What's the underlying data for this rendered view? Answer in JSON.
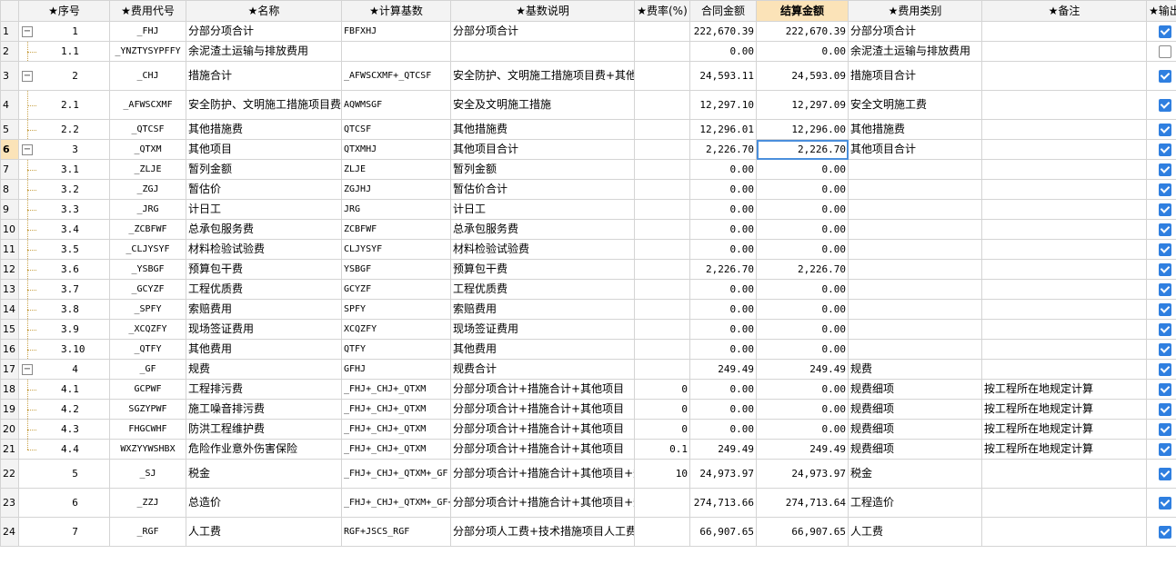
{
  "headers": {
    "seq": "★序号",
    "code": "★费用代号",
    "name": "★名称",
    "base": "★计算基数",
    "desc": "★基数说明",
    "rate": "★费率(%)",
    "contract": "合同金额",
    "settle": "结算金额",
    "category": "★费用类别",
    "note": "★备注",
    "output": "★输出"
  },
  "rows": [
    {
      "n": "1",
      "seq": "1",
      "level": 0,
      "toggle": "−",
      "code": "_FHJ",
      "name": "分部分项合计",
      "base": "FBFXHJ",
      "desc": "分部分项合计",
      "rate": "",
      "contract": "222,670.39",
      "settle": "222,670.39",
      "category": "分部分项合计",
      "note": "",
      "output": true
    },
    {
      "n": "2",
      "seq": "1.1",
      "level": 1,
      "code": "_YNZTYSYPFFY",
      "name": "余泥渣土运输与排放费用",
      "base": "",
      "desc": "",
      "rate": "",
      "contract": "0.00",
      "settle": "0.00",
      "category": "余泥渣土运输与排放费用",
      "note": "",
      "output": false
    },
    {
      "n": "3",
      "seq": "2",
      "level": 0,
      "toggle": "−",
      "code": "_CHJ",
      "name": "措施合计",
      "base": "_AFWSCXMF+_QTCSF",
      "desc": "安全防护、文明施工措施项目费+其他措施费",
      "rate": "",
      "contract": "24,593.11",
      "settle": "24,593.09",
      "category": "措施项目合计",
      "note": "",
      "output": true,
      "tall": true
    },
    {
      "n": "4",
      "seq": "2.1",
      "level": 1,
      "code": "_AFWSCXMF",
      "name": "安全防护、文明施工措施项目费",
      "base": "AQWMSGF",
      "desc": "安全及文明施工措施",
      "rate": "",
      "contract": "12,297.10",
      "settle": "12,297.09",
      "category": "安全文明施工费",
      "note": "",
      "output": true,
      "tall": true
    },
    {
      "n": "5",
      "seq": "2.2",
      "level": 1,
      "code": "_QTCSF",
      "name": "其他措施费",
      "base": "QTCSF",
      "desc": "其他措施费",
      "rate": "",
      "contract": "12,296.01",
      "settle": "12,296.00",
      "category": "其他措施费",
      "note": "",
      "output": true
    },
    {
      "n": "6",
      "seq": "3",
      "level": 0,
      "toggle": "−",
      "code": "_QTXM",
      "name": "其他项目",
      "base": "QTXMHJ",
      "desc": "其他项目合计",
      "rate": "",
      "contract": "2,226.70",
      "settle": "2,226.70",
      "category": "其他项目合计",
      "note": "",
      "output": true,
      "active": true
    },
    {
      "n": "7",
      "seq": "3.1",
      "level": 1,
      "code": "_ZLJE",
      "name": "暂列金额",
      "base": "ZLJE",
      "desc": "暂列金额",
      "rate": "",
      "contract": "0.00",
      "settle": "0.00",
      "category": "",
      "note": "",
      "output": true
    },
    {
      "n": "8",
      "seq": "3.2",
      "level": 1,
      "code": "_ZGJ",
      "name": "暂估价",
      "base": "ZGJHJ",
      "desc": "暂估价合计",
      "rate": "",
      "contract": "0.00",
      "settle": "0.00",
      "category": "",
      "note": "",
      "output": true
    },
    {
      "n": "9",
      "seq": "3.3",
      "level": 1,
      "code": "_JRG",
      "name": "计日工",
      "base": "JRG",
      "desc": "计日工",
      "rate": "",
      "contract": "0.00",
      "settle": "0.00",
      "category": "",
      "note": "",
      "output": true
    },
    {
      "n": "10",
      "seq": "3.4",
      "level": 1,
      "code": "_ZCBFWF",
      "name": "总承包服务费",
      "base": "ZCBFWF",
      "desc": "总承包服务费",
      "rate": "",
      "contract": "0.00",
      "settle": "0.00",
      "category": "",
      "note": "",
      "output": true
    },
    {
      "n": "11",
      "seq": "3.5",
      "level": 1,
      "code": "_CLJYSYF",
      "name": "材料检验试验费",
      "base": "CLJYSYF",
      "desc": "材料检验试验费",
      "rate": "",
      "contract": "0.00",
      "settle": "0.00",
      "category": "",
      "note": "",
      "output": true
    },
    {
      "n": "12",
      "seq": "3.6",
      "level": 1,
      "code": "_YSBGF",
      "name": "预算包干费",
      "base": "YSBGF",
      "desc": "预算包干费",
      "rate": "",
      "contract": "2,226.70",
      "settle": "2,226.70",
      "category": "",
      "note": "",
      "output": true
    },
    {
      "n": "13",
      "seq": "3.7",
      "level": 1,
      "code": "_GCYZF",
      "name": "工程优质费",
      "base": "GCYZF",
      "desc": "工程优质费",
      "rate": "",
      "contract": "0.00",
      "settle": "0.00",
      "category": "",
      "note": "",
      "output": true
    },
    {
      "n": "14",
      "seq": "3.8",
      "level": 1,
      "code": "_SPFY",
      "name": "索赔费用",
      "base": "SPFY",
      "desc": "索赔费用",
      "rate": "",
      "contract": "0.00",
      "settle": "0.00",
      "category": "",
      "note": "",
      "output": true
    },
    {
      "n": "15",
      "seq": "3.9",
      "level": 1,
      "code": "_XCQZFY",
      "name": "现场签证费用",
      "base": "XCQZFY",
      "desc": "现场签证费用",
      "rate": "",
      "contract": "0.00",
      "settle": "0.00",
      "category": "",
      "note": "",
      "output": true
    },
    {
      "n": "16",
      "seq": "3.10",
      "level": 1,
      "code": "_QTFY",
      "name": "其他费用",
      "base": "QTFY",
      "desc": "其他费用",
      "rate": "",
      "contract": "0.00",
      "settle": "0.00",
      "category": "",
      "note": "",
      "output": true
    },
    {
      "n": "17",
      "seq": "4",
      "level": 0,
      "toggle": "−",
      "code": "_GF",
      "name": "规费",
      "base": "GFHJ",
      "desc": "规费合计",
      "rate": "",
      "contract": "249.49",
      "settle": "249.49",
      "category": "规费",
      "note": "",
      "output": true
    },
    {
      "n": "18",
      "seq": "4.1",
      "level": 1,
      "code": "GCPWF",
      "name": "工程排污费",
      "base": "_FHJ+_CHJ+_QTXM",
      "desc": "分部分项合计+措施合计+其他项目",
      "rate": "0",
      "contract": "0.00",
      "settle": "0.00",
      "category": "规费细项",
      "note": "按工程所在地规定计算",
      "output": true
    },
    {
      "n": "19",
      "seq": "4.2",
      "level": 1,
      "code": "SGZYPWF",
      "name": "施工噪音排污费",
      "base": "_FHJ+_CHJ+_QTXM",
      "desc": "分部分项合计+措施合计+其他项目",
      "rate": "0",
      "contract": "0.00",
      "settle": "0.00",
      "category": "规费细项",
      "note": "按工程所在地规定计算",
      "output": true
    },
    {
      "n": "20",
      "seq": "4.3",
      "level": 1,
      "code": "FHGCWHF",
      "name": "防洪工程维护费",
      "base": "_FHJ+_CHJ+_QTXM",
      "desc": "分部分项合计+措施合计+其他项目",
      "rate": "0",
      "contract": "0.00",
      "settle": "0.00",
      "category": "规费细项",
      "note": "按工程所在地规定计算",
      "output": true
    },
    {
      "n": "21",
      "seq": "4.4",
      "level": 1,
      "last": true,
      "code": "WXZYYWSHBX",
      "name": "危险作业意外伤害保险",
      "base": "_FHJ+_CHJ+_QTXM",
      "desc": "分部分项合计+措施合计+其他项目",
      "rate": "0.1",
      "contract": "249.49",
      "settle": "249.49",
      "category": "规费细项",
      "note": "按工程所在地规定计算",
      "output": true
    },
    {
      "n": "22",
      "seq": "5",
      "level": 0,
      "code": "_SJ",
      "name": "税金",
      "base": "_FHJ+_CHJ+_QTXM+_GF",
      "desc": "分部分项合计+措施合计+其他项目+规费",
      "rate": "10",
      "contract": "24,973.97",
      "settle": "24,973.97",
      "category": "税金",
      "note": "",
      "output": true,
      "tall": true
    },
    {
      "n": "23",
      "seq": "6",
      "level": 0,
      "code": "_ZZJ",
      "name": "总造价",
      "base": "_FHJ+_CHJ+_QTXM+_GF+_SJ",
      "desc": "分部分项合计+措施合计+其他项目+规费+税金",
      "rate": "",
      "contract": "274,713.66",
      "settle": "274,713.64",
      "category": "工程造价",
      "note": "",
      "output": true,
      "tall": true
    },
    {
      "n": "24",
      "seq": "7",
      "level": 0,
      "code": "_RGF",
      "name": "人工费",
      "base": "RGF+JSCS_RGF",
      "desc": "分部分项人工费+技术措施项目人工费",
      "rate": "",
      "contract": "66,907.65",
      "settle": "66,907.65",
      "category": "人工费",
      "note": "",
      "output": true,
      "tall": true
    }
  ]
}
